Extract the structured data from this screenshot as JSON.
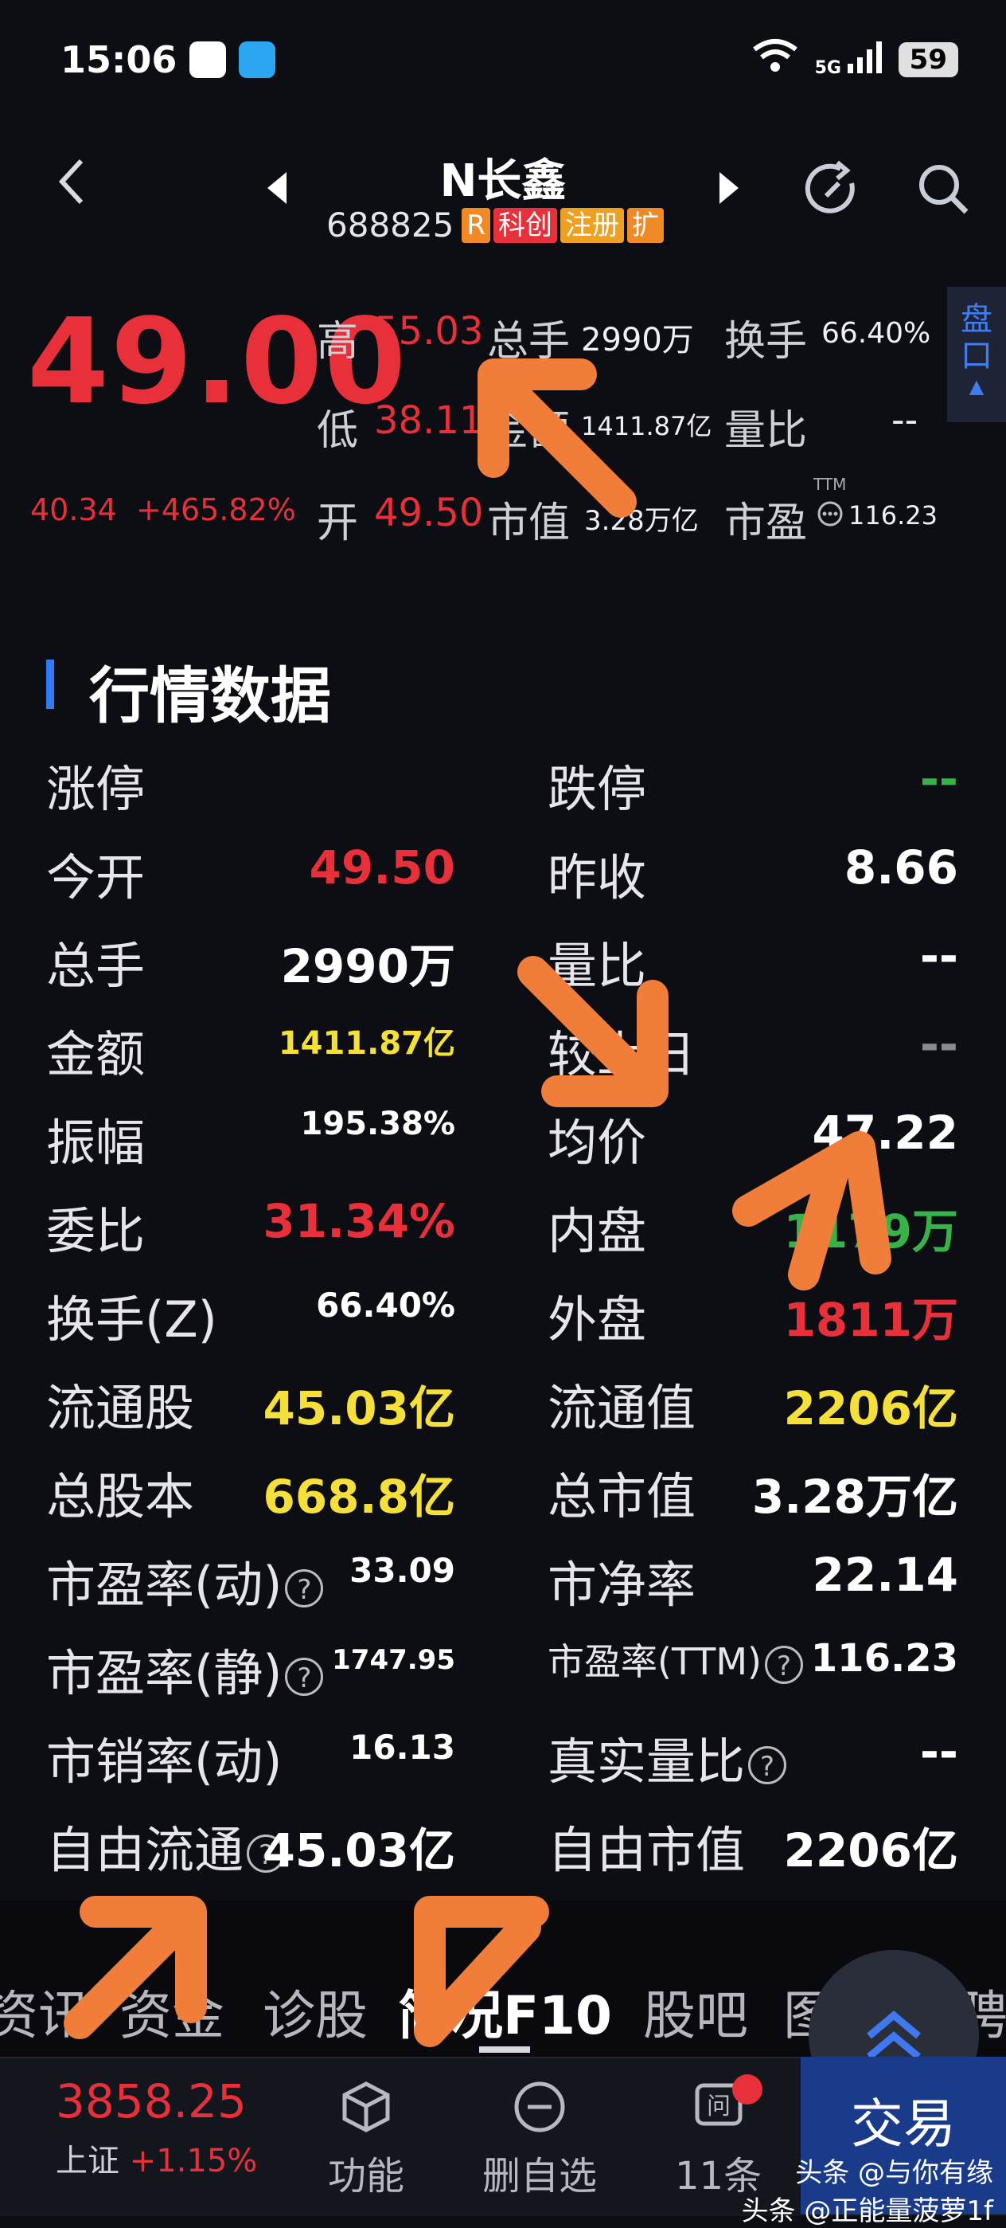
{
  "status_bar": {
    "time": "15:06",
    "network": "5G",
    "battery": "59"
  },
  "header": {
    "title": "N长鑫",
    "code": "688825",
    "tags": [
      {
        "text": "R",
        "color": "#f08a24"
      },
      {
        "text": "科创",
        "color": "#e8303a"
      },
      {
        "text": "注册",
        "color": "#f0a020"
      },
      {
        "text": "扩",
        "color": "#f08a24"
      }
    ]
  },
  "quote": {
    "price": "49.00",
    "change": "40.34",
    "change_pct": "+465.82%",
    "high_label": "高",
    "high": "55.03",
    "low_label": "低",
    "low": "38.11",
    "open_label": "开",
    "open": "49.50",
    "volume_label": "总手",
    "volume": "2990万",
    "amount_label": "金额",
    "amount": "1411.87亿",
    "mktcap_label": "市值",
    "mktcap": "3.28万亿",
    "turnover_label": "换手",
    "turnover": "66.40%",
    "volratio_label": "量比",
    "volratio": "--",
    "pe_label": "市盈",
    "pe_sup": "TTM",
    "pe": "116.23",
    "pankou": "盘口"
  },
  "section_title": "行情数据",
  "market_rows": [
    {
      "l1": "涨停",
      "v1": "",
      "c1": "#e8303a",
      "l2": "跌停",
      "v2": "--",
      "c2": "#37b34a"
    },
    {
      "l1": "今开",
      "v1": "49.50",
      "c1": "#e8303a",
      "l2": "昨收",
      "v2": "8.66",
      "c2": "#ffffff"
    },
    {
      "l1": "总手",
      "v1": "2990万",
      "c1": "#ffffff",
      "l2": "量比",
      "v2": "--",
      "c2": "#ffffff"
    },
    {
      "l1": "金额",
      "v1": "1411.87亿",
      "c1": "#f5e03a",
      "l2": "较上日",
      "v2": "--",
      "c2": "#8a8a92"
    },
    {
      "l1": "振幅",
      "v1": "195.38%",
      "c1": "#ffffff",
      "l2": "均价",
      "v2": "47.22",
      "c2": "#ffffff"
    },
    {
      "l1": "委比",
      "v1": "31.34%",
      "c1": "#e8303a",
      "l2": "内盘",
      "v2": "1179万",
      "c2": "#37b34a"
    },
    {
      "l1": "换手(Z)",
      "v1": "66.40%",
      "c1": "#ffffff",
      "l2": "外盘",
      "v2": "1811万",
      "c2": "#e8303a"
    },
    {
      "l1": "流通股",
      "v1": "45.03亿",
      "c1": "#f5e03a",
      "l2": "流通值",
      "v2": "2206亿",
      "c2": "#f5e03a"
    },
    {
      "l1": "总股本",
      "v1": "668.8亿",
      "c1": "#f5e03a",
      "l2": "总市值",
      "v2": "3.28万亿",
      "c2": "#ffffff"
    },
    {
      "l1": "市盈率(动)",
      "q1": true,
      "v1": "33.09",
      "c1": "#ffffff",
      "l2": "市净率",
      "v2": "22.14",
      "c2": "#ffffff"
    },
    {
      "l1": "市盈率(静)",
      "q1": true,
      "v1": "1747.95",
      "c1": "#ffffff",
      "l2": "市盈率(TTM)",
      "q2": true,
      "v2": "116.23",
      "c2": "#ffffff"
    },
    {
      "l1": "市销率(动)",
      "v1": "16.13",
      "c1": "#ffffff",
      "l2": "真实量比",
      "q2": true,
      "v2": "--",
      "c2": "#ffffff"
    },
    {
      "l1": "自由流通",
      "q1": true,
      "v1": "45.03亿",
      "c1": "#ffffff",
      "l2": "自由市值",
      "v2": "2206亿",
      "c2": "#ffffff"
    }
  ],
  "tabs": [
    "资讯",
    "资金",
    "诊股",
    "简况F10",
    "股吧",
    "图谱",
    "招聘"
  ],
  "bottom": {
    "index_value": "3858.25",
    "index_name": "上证",
    "index_change": "+1.15%",
    "func": "功能",
    "remove": "删自选",
    "messages": "11条",
    "trade": "交易"
  },
  "watermark": [
    "头条 @与你有缘",
    "头条 @正能量菠萝1f"
  ],
  "colors": {
    "red": "#e8303a",
    "green": "#37b34a",
    "yellow": "#f5e03a",
    "accent": "#2f7af5",
    "arrow": "#f07e3a"
  }
}
